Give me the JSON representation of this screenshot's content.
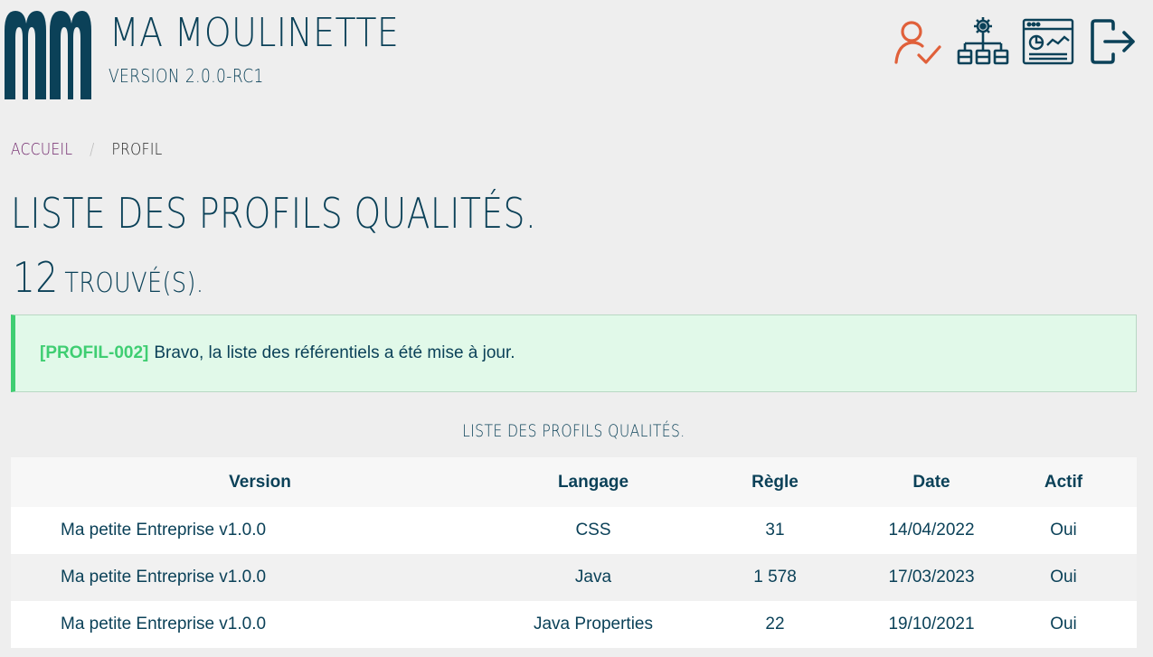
{
  "header": {
    "app_title": "MA MOULINETTE",
    "app_version": "VERSION 2.0.0-RC1",
    "icons": [
      "user-check-icon",
      "gear-network-icon",
      "dashboard-icon",
      "logout-icon"
    ]
  },
  "breadcrumb": {
    "home": "ACCUEIL",
    "separator": "/",
    "current": "PROFIL"
  },
  "page": {
    "title": "LISTE DES PROFILS QUALITÉS.",
    "count": "12",
    "count_label": "TROUVÉ(S)."
  },
  "alert": {
    "code": "[PROFIL-002]",
    "message": "Bravo, la liste des référentiels a été mise à jour."
  },
  "table": {
    "caption": "LISTE DES PROFILS QUALITÉS.",
    "headers": [
      "Version",
      "Langage",
      "Règle",
      "Date",
      "Actif"
    ],
    "rows": [
      [
        "Ma petite Entreprise v1.0.0",
        "CSS",
        "31",
        "14/04/2022",
        "Oui"
      ],
      [
        "Ma petite Entreprise v1.0.0",
        "Java",
        "1 578",
        "17/03/2023",
        "Oui"
      ],
      [
        "Ma petite Entreprise v1.0.0",
        "Java Properties",
        "22",
        "19/10/2021",
        "Oui"
      ]
    ]
  },
  "colors": {
    "primary": "#0b4158",
    "accent_orange": "#e0603a",
    "link": "#6b1e66",
    "success": "#3fce72",
    "success_bg": "#e1f9e9"
  }
}
